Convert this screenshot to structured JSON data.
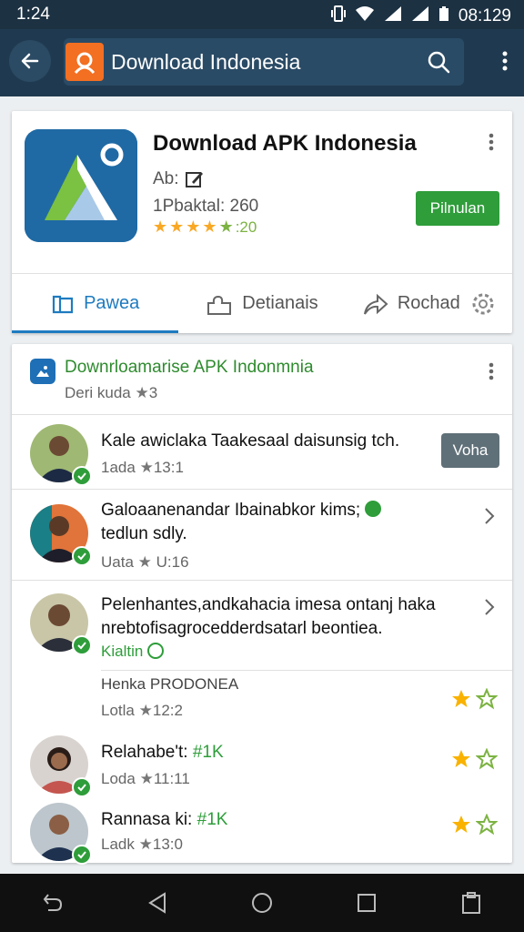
{
  "status_bar": {
    "time": "1:24",
    "clock_right": "08:129"
  },
  "app_bar": {
    "title": "Download Indonesia"
  },
  "app_card": {
    "name": "Download APK Indonesia",
    "meta_line1": "Ab:",
    "meta_line2": "1Pbaktal: 260",
    "rating_value": ":20",
    "install_label": "Pilnulan"
  },
  "tabs": [
    {
      "label": "Pawea",
      "icon": "book-icon",
      "active": true
    },
    {
      "label": "Detianais",
      "icon": "puzzle-icon",
      "active": false
    },
    {
      "label": "Rochad",
      "icon": "share-icon",
      "active": false
    }
  ],
  "list_card": {
    "title": "Downrloamarise APK Indonmnia",
    "subtitle": "Deri kuda",
    "subtitle_rating": "3",
    "rows": [
      {
        "title": "Kale awiclaka Taakesaal daisunsig tch.",
        "meta": "1ada",
        "meta_rating": "13:1",
        "action": "Voha"
      },
      {
        "title_line1": "Galoaanenandar Ibainabkor kims;",
        "title_line2": "tedlun sdly.",
        "meta": "Uata",
        "meta_rating": "U:16"
      },
      {
        "title_line1": "Pelenhantes,andkahacia imesa ontanj haka",
        "title_line2": "nrebtofisagrocedderdsatarl beontiea.",
        "tag": "Kialtin",
        "sub_title": "Henka PRODONEA",
        "meta": "Lotla",
        "meta_rating": "12:2"
      },
      {
        "title": "Relahabe't:",
        "title_tag": "#1K",
        "meta": "Loda",
        "meta_rating": "11:11"
      },
      {
        "title": "Rannasa ki:",
        "title_tag": "#1K",
        "meta": "Ladk",
        "meta_rating": "13:0"
      }
    ]
  },
  "colors": {
    "appbar": "#1f3a50",
    "accent": "#1e7bc0",
    "install": "#2e9d3a",
    "logo": "#f36f21"
  }
}
